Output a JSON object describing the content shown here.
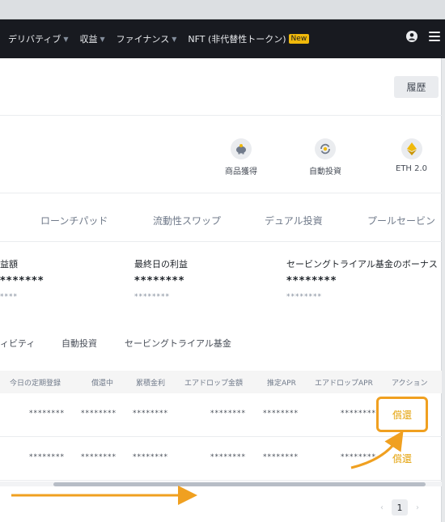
{
  "nav": {
    "items": [
      {
        "label": "デリバティブ",
        "caret": "▼"
      },
      {
        "label": "収益",
        "caret": "▼"
      },
      {
        "label": "ファイナンス",
        "caret": "▼"
      },
      {
        "label": "NFT (非代替性トークン)",
        "badge": "New"
      }
    ]
  },
  "header": {
    "history_label": "履歴"
  },
  "features": [
    {
      "label": "商品獲得",
      "icon": "piggy-bank-icon"
    },
    {
      "label": "自動投資",
      "icon": "auto-invest-icon"
    },
    {
      "label": "ETH 2.0",
      "icon": "eth-icon"
    }
  ],
  "product_tabs": [
    "ローンチパッド",
    "流動性スワップ",
    "デュアル投資",
    "プールセービン"
  ],
  "stats": [
    {
      "label": "益額",
      "value": "*******",
      "sub": "****"
    },
    {
      "label": "最終日の利益",
      "value": "********",
      "sub": "********"
    },
    {
      "label": "セービングトライアル基金のボーナス",
      "value": "********",
      "sub": "********"
    }
  ],
  "sub_tabs": [
    "ィビティ",
    "自動投資",
    "セービングトライアル基金"
  ],
  "table": {
    "headers": [
      "今日の定期登録",
      "償還中",
      "累積金利",
      "エアドロップ金額",
      "推定APR",
      "エアドロップAPR",
      "アクション"
    ],
    "rows": [
      {
        "cells": [
          "********",
          "********",
          "********",
          "********",
          "********",
          "********"
        ],
        "action": "償還"
      },
      {
        "cells": [
          "********",
          "********",
          "********",
          "********",
          "********",
          "********"
        ],
        "action": "償還"
      }
    ]
  },
  "pagination": {
    "prev": "‹",
    "current": "1",
    "next": "›"
  },
  "colors": {
    "accent": "#f0a020",
    "brand": "#f0b90b",
    "nav_bg": "#181a20"
  }
}
